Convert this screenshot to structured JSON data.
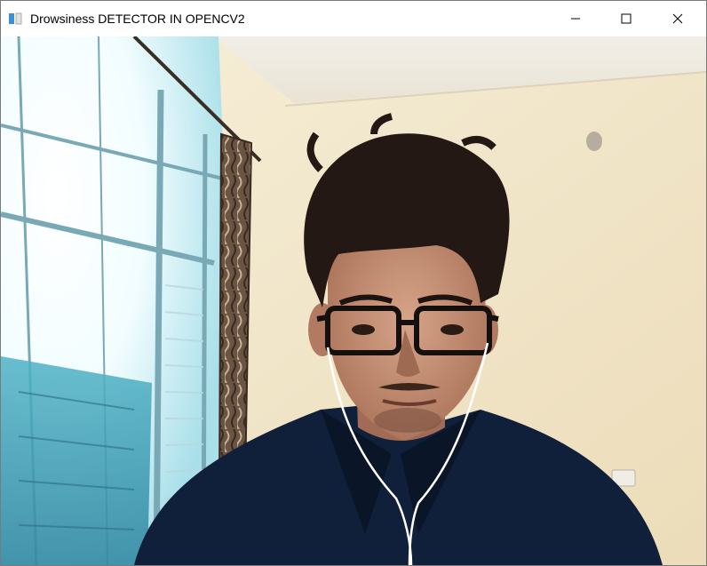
{
  "window": {
    "title": "Drowsiness DETECTOR IN OPENCV2",
    "icon": "opencv-window-icon",
    "controls": [
      "minimize-icon",
      "maximize-icon",
      "close-icon"
    ]
  },
  "video": {
    "content": "webcam-frame"
  },
  "colors": {
    "wall": "#f4ead2",
    "window_glare": "#e9fbff",
    "curtain": "#5c4a3c",
    "shirt": "#10203a",
    "hair": "#231813"
  }
}
